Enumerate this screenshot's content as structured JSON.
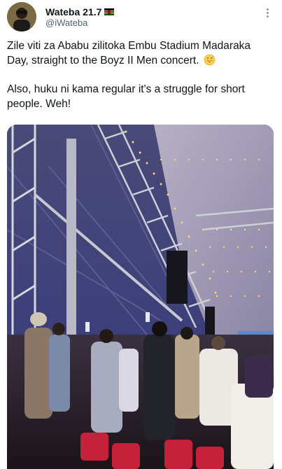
{
  "tweet": {
    "author": {
      "display_name": "Wateba 21.7",
      "handle": "@iWateba",
      "flag_icon": "kenya-flag-icon"
    },
    "more_icon": "more-options-icon",
    "text_line_1": "Zile viti za Ababu zilitoka Embu Stadium Madaraka Day, straight to the Boyz II Men concert.",
    "text_line_1_emoji": "grinning-sweat-emoji",
    "text_line_2": "Also, huku ni kama regular it's a struggle for short people. Weh!"
  },
  "colors": {
    "text": "#0f1419",
    "secondary_text": "#536471",
    "tent_canopy": "#3a3a6e",
    "truss_metal": "#c9c9d2",
    "string_lights": "#ffd27a"
  }
}
